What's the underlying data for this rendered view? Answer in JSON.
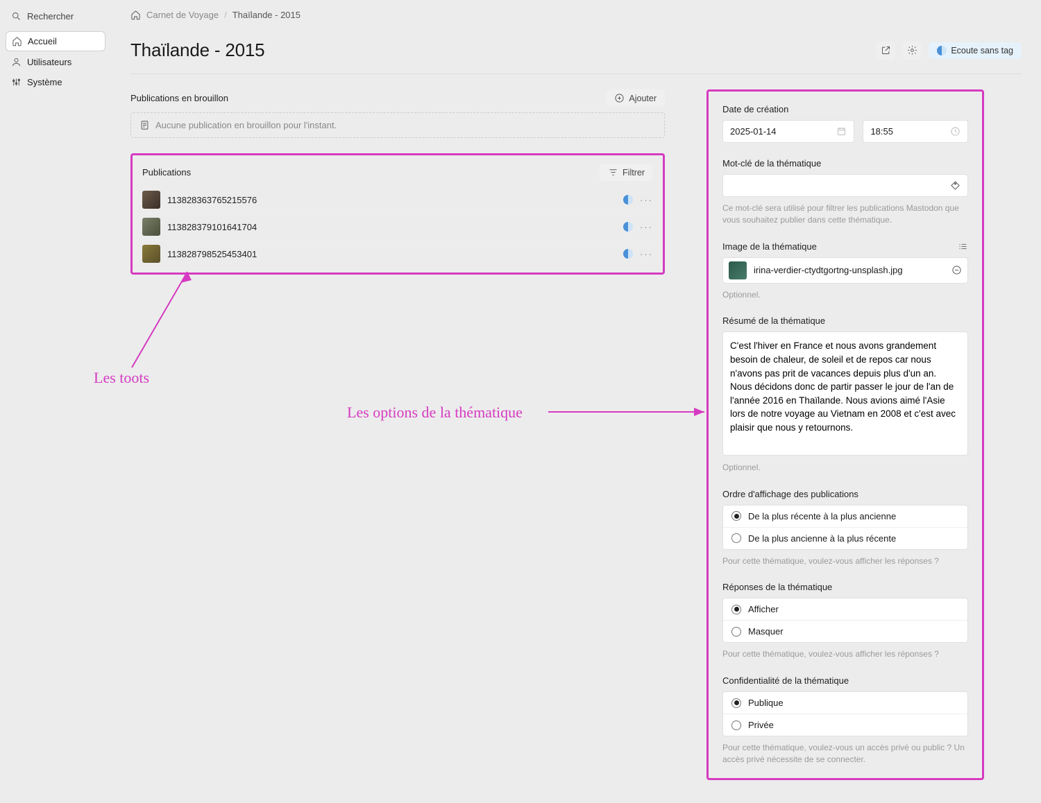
{
  "sidebar": {
    "search": "Rechercher",
    "items": [
      {
        "label": "Accueil"
      },
      {
        "label": "Utilisateurs"
      },
      {
        "label": "Système"
      }
    ]
  },
  "breadcrumb": {
    "root": "Carnet de Voyage",
    "current": "Thaïlande - 2015"
  },
  "title": "Thaïlande - 2015",
  "listen_pill": "Ecoute sans tag",
  "drafts": {
    "header": "Publications en brouillon",
    "add": "Ajouter",
    "empty": "Aucune publication en brouillon pour l'instant."
  },
  "pubs": {
    "header": "Publications",
    "filter": "Filtrer",
    "items": [
      {
        "id": "113828363765215576"
      },
      {
        "id": "113828379101641704"
      },
      {
        "id": "113828798525453401"
      }
    ]
  },
  "right": {
    "created_label": "Date de création",
    "date": "2025-01-14",
    "time": "18:55",
    "keyword_label": "Mot-clé de la thématique",
    "keyword_help": "Ce mot-clé sera utilisé pour filtrer les publications Mastodon que vous souhaitez publier dans cette thématique.",
    "image_label": "Image de la thématique",
    "image_name": "irina-verdier-ctydtgortng-unsplash.jpg",
    "optional": "Optionnel.",
    "summary_label": "Résumé de la thématique",
    "summary": "C'est l'hiver en France et nous avons grandement besoin de chaleur, de soleil et de repos car nous n'avons pas prit de vacances depuis plus d'un an. Nous décidons donc de partir passer le jour de l'an de l'année 2016 en Thaïlande. Nous avions aimé l'Asie lors de notre voyage au Vietnam en 2008 et c'est avec plaisir que nous y retournons.",
    "order_label": "Ordre d'affichage des publications",
    "order_opts": [
      "De la plus récente à la plus ancienne",
      "De la plus ancienne à la plus récente"
    ],
    "order_help": "Pour cette thématique, voulez-vous afficher les réponses ?",
    "replies_label": "Réponses de la thématique",
    "replies_opts": [
      "Afficher",
      "Masquer"
    ],
    "replies_help": "Pour cette thématique, voulez-vous afficher les réponses ?",
    "privacy_label": "Confidentialité de la thématique",
    "privacy_opts": [
      "Publique",
      "Privée"
    ],
    "privacy_help": "Pour cette thématique, voulez-vous un accès privé ou public ? Un accès privé nécessite de se connecter."
  },
  "annotations": {
    "toots": "Les toots",
    "options": "Les options de la thématique"
  }
}
